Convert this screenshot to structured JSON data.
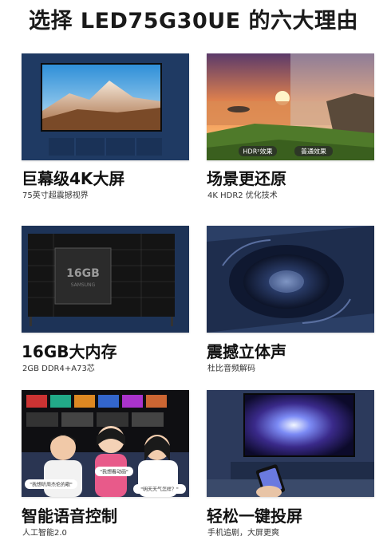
{
  "page_title": "选择 LED75G30UE 的六大理由",
  "features": [
    {
      "title": "巨幕级4K大屏",
      "subtitle": "75英寸超震撼视界"
    },
    {
      "title": "场景更还原",
      "subtitle": "4K HDR2 优化技术",
      "tags": [
        "HDR²效果",
        "普通效果"
      ]
    },
    {
      "title": "16GB大内存",
      "subtitle": "2GB DDR4+A73芯",
      "chip_text": "16GB",
      "chip_sub": "SAMSUNG"
    },
    {
      "title": "震撼立体声",
      "subtitle": "杜比音频解码"
    },
    {
      "title": "智能语音控制",
      "subtitle": "人工智能2.0",
      "bubbles": [
        "\"我想听周杰伦的歌\"",
        "\"我想看动画\"",
        "\"明天天气怎样？\""
      ]
    },
    {
      "title": "轻松一键投屏",
      "subtitle": "手机追剧，大屏更爽"
    }
  ]
}
